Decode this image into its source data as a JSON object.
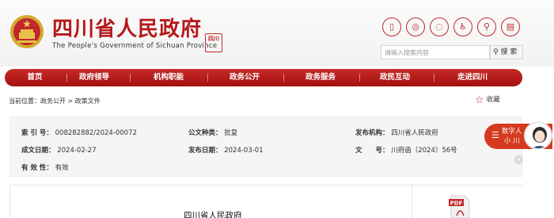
{
  "header": {
    "title": "四川省人民政府",
    "subtitle": "The People's Government of Sichuan Province",
    "seal_text": "四川"
  },
  "top_icons": [
    "mobile-icon",
    "weibo-icon",
    "wechat-icon",
    "accessibility-icon",
    "elderly-mode-icon",
    "building-icon"
  ],
  "search": {
    "placeholder": "请输入搜索内容",
    "button_label": "搜 索"
  },
  "nav": {
    "items": [
      {
        "label": "首页"
      },
      {
        "label": "政府领导"
      },
      {
        "label": "机构职能"
      },
      {
        "label": "政务公开"
      },
      {
        "label": "政务服务"
      },
      {
        "label": "政民互动"
      },
      {
        "label": "走进四川"
      }
    ]
  },
  "breadcrumb": {
    "prefix": "当前位置：",
    "level1": "政务公开",
    "separator": " > ",
    "level2": "政策文件"
  },
  "favorite_label": "收藏",
  "info": {
    "index_label": "索 引 号：",
    "index_value": "008282882/2024-00072",
    "category_label": "公文种类：",
    "category_value": "批复",
    "publisher_label": "发布机构：",
    "publisher_value": "四川省人民政府",
    "created_label": "成文日期：",
    "created_value": "2024-02-27",
    "published_label": "发布日期：",
    "published_value": "2024-03-01",
    "docno_label": "文　　号：",
    "docno_value": "川府函〔2024〕56号",
    "validity_label": "有 效 性：",
    "validity_value": "有效"
  },
  "document": {
    "issuer": "四川省人民政府"
  },
  "assistant": {
    "line1": "数字人",
    "line2": "小 川"
  },
  "colors": {
    "brand_red": "#b5181b",
    "nav_red": "#c62a26",
    "assistant_orange": "#d43a1f"
  }
}
